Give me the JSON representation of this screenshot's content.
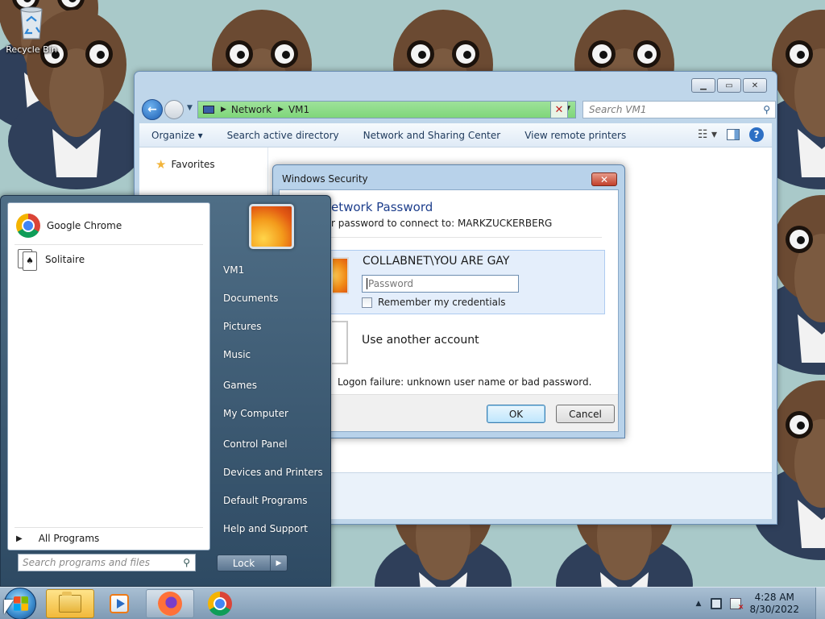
{
  "desktop": {
    "recycle_bin_label": "Recycle Bin"
  },
  "explorer": {
    "address": {
      "crumb1": "Network",
      "crumb2": "VM1"
    },
    "search_placeholder": "Search VM1",
    "toolbar": {
      "organize": "Organize ▾",
      "search_ad": "Search active directory",
      "network_sharing": "Network and Sharing Center",
      "remote_printers": "View remote printers"
    },
    "nav_favorites": "Favorites"
  },
  "dialog": {
    "title": "Windows Security",
    "heading": "etwork Password",
    "subheading": "r password to connect to: MARKZUCKERBERG",
    "credential_user": "COLLABNET\\YOU ARE GAY",
    "password_placeholder": "Password",
    "remember_label": "Remember my credentials",
    "other_account": "Use another account",
    "error_text": "Logon failure: unknown user name or bad password.",
    "ok_label": "OK",
    "cancel_label": "Cancel"
  },
  "start_menu": {
    "pinned": [
      "Google Chrome",
      "Solitaire"
    ],
    "all_programs": "All Programs",
    "search_placeholder": "Search programs and files",
    "right_items": [
      "VM1",
      "Documents",
      "Pictures",
      "Music",
      "Games",
      "My Computer",
      "Control Panel",
      "Devices and Printers",
      "Default Programs",
      "Help and Support"
    ],
    "lock_label": "Lock"
  },
  "taskbar": {
    "time": "4:28 AM",
    "date": "8/30/2022"
  },
  "colors": {
    "wallpaper_bg": "#a9c9c9",
    "address_bar": "#8edb89",
    "dialog_heading": "#1d3e8c"
  }
}
